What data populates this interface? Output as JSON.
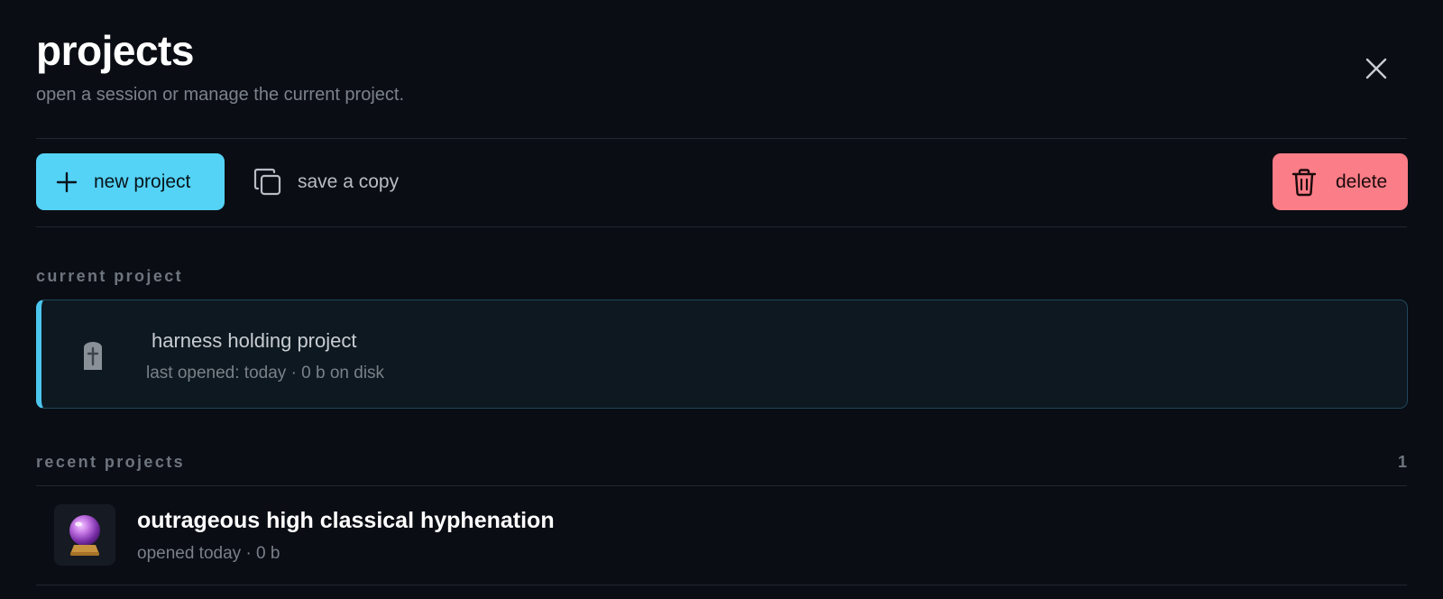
{
  "header": {
    "title": "projects",
    "subtitle": "open a session or manage the current project."
  },
  "toolbar": {
    "new_label": "new project",
    "copy_label": "save a copy",
    "delete_label": "delete"
  },
  "current": {
    "section_label": "current project",
    "name": "harness holding project",
    "meta": "last opened: today · 0 b on disk",
    "icon": "tombstone-icon"
  },
  "recent": {
    "section_label": "recent projects",
    "count": "1",
    "items": [
      {
        "name": "outrageous high classical hyphenation",
        "meta": "opened today · 0 b",
        "icon": "crystal-ball-icon"
      }
    ]
  },
  "colors": {
    "background": "#0a0d14",
    "accent": "#54d3f7",
    "danger": "#fb7d87",
    "card_border": "#21475a"
  }
}
